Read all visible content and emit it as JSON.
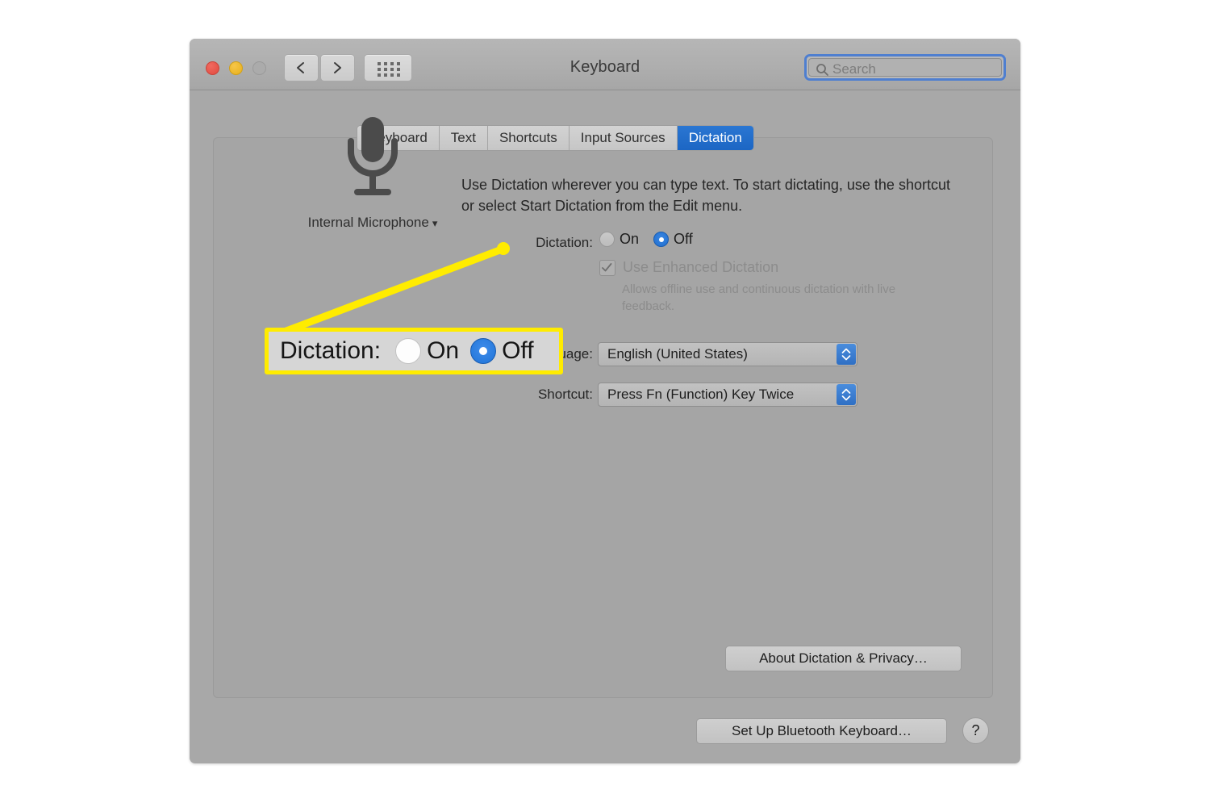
{
  "window": {
    "title": "Keyboard",
    "traffic_lights": [
      "close",
      "minimize",
      "zoom-disabled"
    ],
    "nav": {
      "back": "back-chevron",
      "forward": "forward-chevron",
      "show_all": "grid-icon"
    },
    "search": {
      "placeholder": "Search",
      "value": "",
      "icon": "search-icon",
      "focused": true
    }
  },
  "tabs": [
    {
      "label": "Keyboard",
      "selected": false
    },
    {
      "label": "Text",
      "selected": false
    },
    {
      "label": "Shortcuts",
      "selected": false
    },
    {
      "label": "Input Sources",
      "selected": false
    },
    {
      "label": "Dictation",
      "selected": true
    }
  ],
  "microphone": {
    "icon": "microphone-icon",
    "label": "Internal Microphone",
    "caret": "⌄"
  },
  "description": "Use Dictation wherever you can type text. To start dictating, use the shortcut or select Start Dictation from the Edit menu.",
  "form": {
    "dictation": {
      "label": "Dictation:",
      "options": [
        {
          "label": "On",
          "selected": false
        },
        {
          "label": "Off",
          "selected": true
        }
      ]
    },
    "enhanced_dictation": {
      "label": "Use Enhanced Dictation",
      "checked": true,
      "disabled": true,
      "sublabel": "Allows offline use and continuous dictation with live feedback."
    },
    "language": {
      "label": "Language:",
      "value": "English (United States)"
    },
    "shortcut": {
      "label": "Shortcut:",
      "value": "Press Fn (Function) Key Twice"
    }
  },
  "buttons": {
    "about_dictation": "About Dictation & Privacy…",
    "setup_bluetooth": "Set Up Bluetooth Keyboard…",
    "help": "?"
  },
  "callout": {
    "label": "Dictation:",
    "options": [
      {
        "label": "On",
        "selected": false
      },
      {
        "label": "Off",
        "selected": true
      }
    ],
    "highlight_color": "#ffec00",
    "pointer": "yellow-leader-line"
  },
  "colors": {
    "accent_blue": "#1e6ed0",
    "highlight_yellow": "#ffec00",
    "window_bg": "#a8a8a8",
    "panel_bg": "#a5a5a5"
  }
}
